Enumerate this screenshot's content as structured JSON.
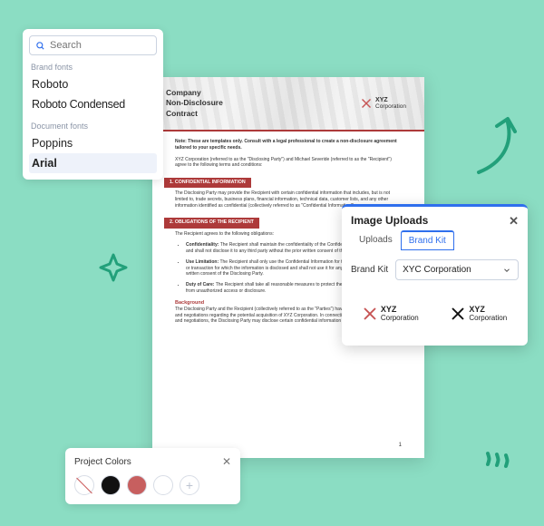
{
  "fontPanel": {
    "searchPlaceholder": "Search",
    "sections": {
      "brand": {
        "label": "Brand fonts",
        "items": [
          "Roboto",
          "Roboto Condensed"
        ]
      },
      "document": {
        "label": "Document fonts",
        "items": [
          "Poppins",
          "Arial"
        ]
      }
    },
    "selected": "Arial"
  },
  "document": {
    "titleLines": [
      "Company",
      "Non-Disclosure",
      "Contract"
    ],
    "logoText": "XYZ\nCorporation",
    "note": "Note: These are templates only. Consult with a legal professional to create a non-disclosure agreement tailored to your specific needs.",
    "intro": "XYZ Corporation (referred to as the \"Disclosing Party\") and Michael Severide (referred to as the \"Recipient\") agree to the following terms and conditions:",
    "sections": [
      {
        "heading": "1. CONFIDENTIAL INFORMATION",
        "body": "The Disclosing Party may provide the Recipient with certain confidential information that includes, but is not limited to, trade secrets, business plans, financial information, technical data, customer lists, and any other information identified as confidential (collectively referred to as \"Confidential Information\")."
      },
      {
        "heading": "2. OBLIGATIONS OF THE RECIPIENT",
        "body": "The Recipient agrees to the following obligations:",
        "bullets": [
          {
            "term": "Confidentiality:",
            "text": "The Recipient shall maintain the confidentiality of the Confidential Information received and shall not disclose it to any third party without the prior written consent of the Disclosing Party."
          },
          {
            "term": "Use Limitation:",
            "text": "The Recipient shall only use the Confidential Information for the specific purpose, project, or transaction for which the information is disclosed and shall not use it for any other purpose without the written consent of the Disclosing Party."
          },
          {
            "term": "Duty of Care:",
            "text": "The Recipient shall take all reasonable measures to protect the Confidential Information from unauthorized access or disclosure."
          }
        ]
      }
    ],
    "background": {
      "heading": "Background",
      "body": "The Disclosing Party and the Recipient (collectively referred to as the \"Parties\") have engaged in discussions and negotiations regarding the potential acquisition of XYZ Corporation. In connection with these discussions and negotiations, the Disclosing Party may disclose certain confidential information to the Recipient."
    },
    "pageNumber": "1"
  },
  "uploads": {
    "title": "Image Uploads",
    "tabs": [
      "Uploads",
      "Brand Kit"
    ],
    "activeTab": "Brand Kit",
    "brandKitLabel": "Brand Kit",
    "brandKitSelected": "XYC Corporation",
    "logos": [
      {
        "name": "XYZ",
        "sub": "Corporation",
        "color": "#c75454"
      },
      {
        "name": "XYZ",
        "sub": "Corporation",
        "color": "#111111"
      }
    ]
  },
  "colorsPanel": {
    "title": "Project Colors",
    "swatches": [
      {
        "type": "none"
      },
      {
        "type": "color",
        "value": "#111111"
      },
      {
        "type": "color",
        "value": "#c75f5f"
      },
      {
        "type": "color",
        "value": "#ffffff"
      },
      {
        "type": "add"
      }
    ]
  }
}
